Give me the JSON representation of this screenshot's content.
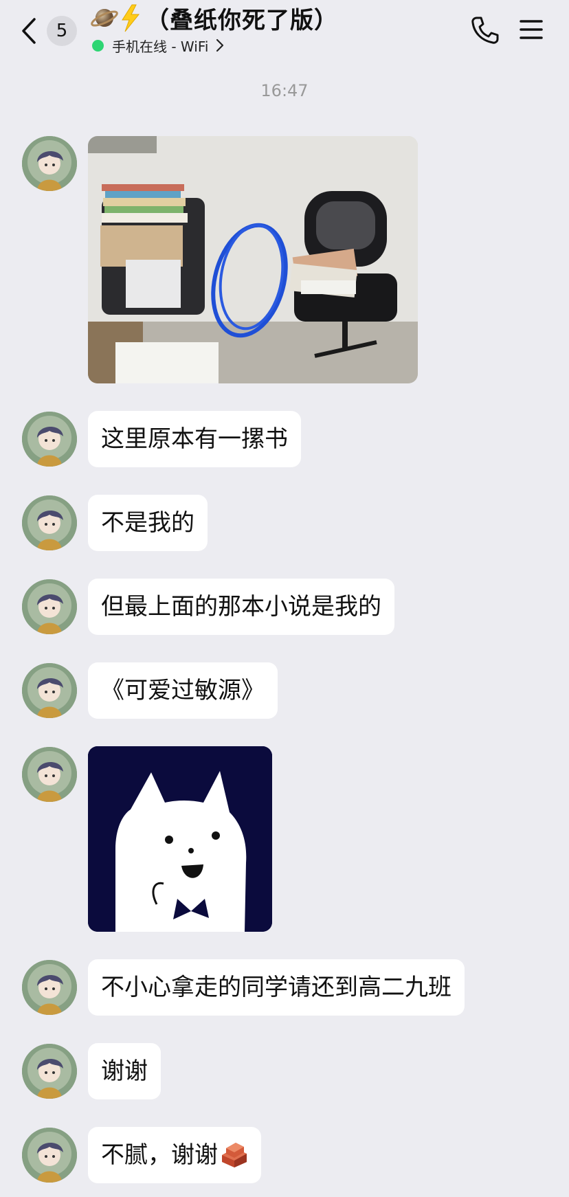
{
  "header": {
    "unread_count": "5",
    "title": "（叠纸你死了版）",
    "title_emojis": [
      "ringed-planet-emoji",
      "lightning-emoji"
    ],
    "status": "手机在线 - WiFi",
    "status_color": "#2ed573"
  },
  "timestamp": "16:47",
  "messages": [
    {
      "type": "image",
      "content": "photo of two chairs with stacked books and a blue circle drawn around an empty spot"
    },
    {
      "type": "text",
      "text": "这里原本有一摞书"
    },
    {
      "type": "text",
      "text": "不是我的"
    },
    {
      "type": "text",
      "text": "但最上面的那本小说是我的"
    },
    {
      "type": "text",
      "text": "《可爱过敏源》"
    },
    {
      "type": "sticker",
      "content": "white cat with bow tie on dark navy background"
    },
    {
      "type": "text",
      "text": "不小心拿走的同学请还到高二九班"
    },
    {
      "type": "text",
      "text": "谢谢"
    },
    {
      "type": "text",
      "text": "不腻，谢谢",
      "trailing_emoji": "brick-emoji"
    }
  ],
  "colors": {
    "background": "#ececf1",
    "bubble": "#ffffff",
    "online": "#2ed573",
    "timestamp": "#999999"
  }
}
